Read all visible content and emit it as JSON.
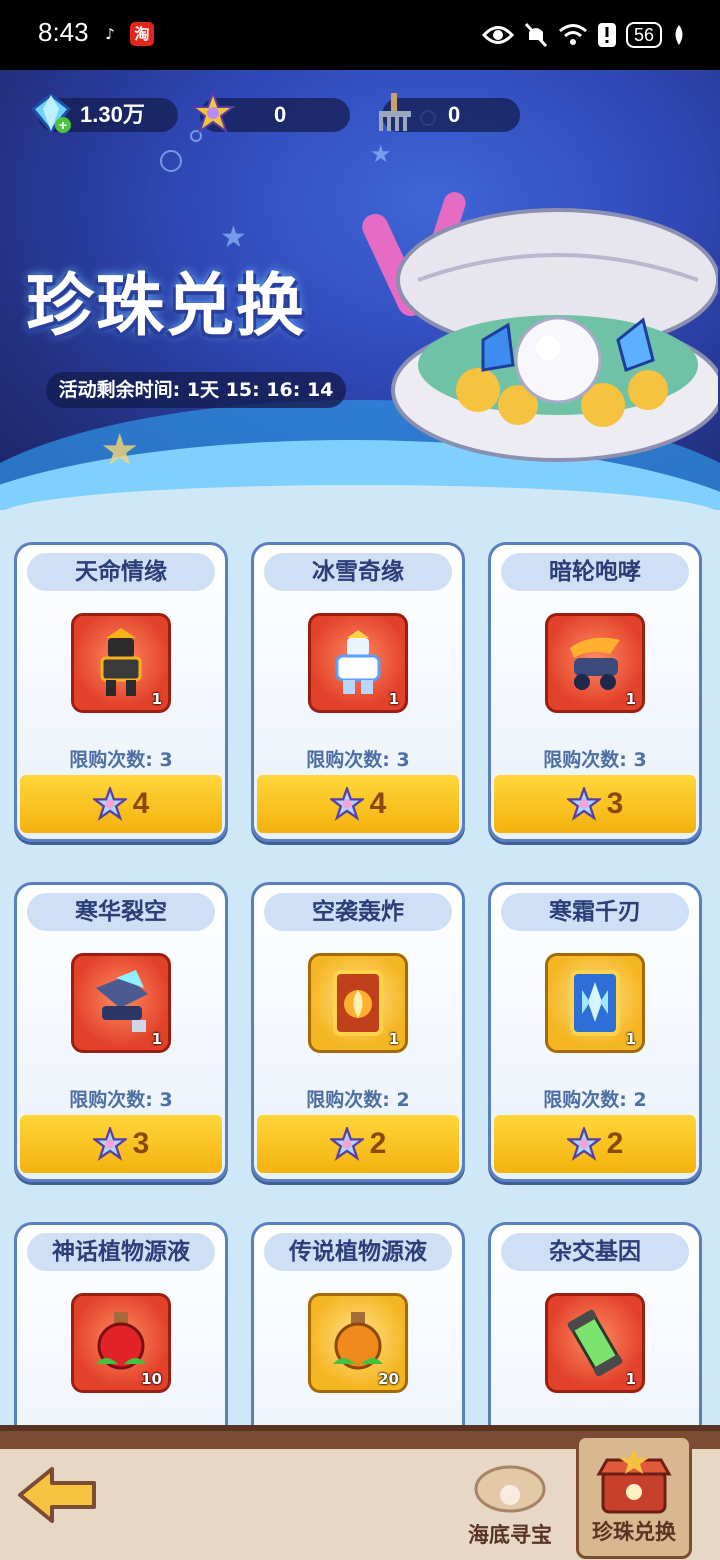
{
  "status_bar": {
    "time": "8:43",
    "battery": "56",
    "apps": [
      {
        "icon": "tiktok-icon",
        "glyph": "♪"
      },
      {
        "icon": "taobao-icon",
        "glyph": "淘"
      }
    ]
  },
  "resources": {
    "diamond": "1.30万",
    "pearl_star": "0",
    "rake": "0"
  },
  "banner": {
    "title": "珍珠兑换",
    "timer": "活动剩余时间: 1天 15: 16: 14"
  },
  "items": [
    {
      "name": "天命情缘",
      "qty": "1",
      "limit": "限购次数: 3",
      "cost": "4",
      "tier": "red",
      "icon": "mech-warrior-icon"
    },
    {
      "name": "冰雪奇缘",
      "qty": "1",
      "limit": "限购次数: 3",
      "cost": "4",
      "tier": "red",
      "icon": "ice-knight-icon"
    },
    {
      "name": "暗轮咆哮",
      "qty": "1",
      "limit": "限购次数: 3",
      "cost": "3",
      "tier": "red",
      "icon": "flame-tank-icon"
    },
    {
      "name": "寒华裂空",
      "qty": "1",
      "limit": "限购次数: 3",
      "cost": "3",
      "tier": "red",
      "icon": "frost-cannon-icon"
    },
    {
      "name": "空袭轰炸",
      "qty": "1",
      "limit": "限购次数: 2",
      "cost": "2",
      "tier": "gold",
      "icon": "airstrike-card-icon"
    },
    {
      "name": "寒霜千刃",
      "qty": "1",
      "limit": "限购次数: 2",
      "cost": "2",
      "tier": "gold",
      "icon": "frost-blades-card-icon"
    },
    {
      "name": "神话植物源液",
      "qty": "10",
      "limit": "",
      "cost": "",
      "tier": "red",
      "icon": "red-potion-icon"
    },
    {
      "name": "传说植物源液",
      "qty": "20",
      "limit": "",
      "cost": "",
      "tier": "gold",
      "icon": "orange-potion-icon"
    },
    {
      "name": "杂交基因",
      "qty": "1",
      "limit": "",
      "cost": "",
      "tier": "red",
      "icon": "gene-capsule-icon"
    }
  ],
  "bottom_nav": {
    "tabs": [
      {
        "label": "海底寻宝",
        "icon": "clam-icon"
      },
      {
        "label": "珍珠兑换",
        "icon": "treasure-shop-icon"
      }
    ]
  }
}
